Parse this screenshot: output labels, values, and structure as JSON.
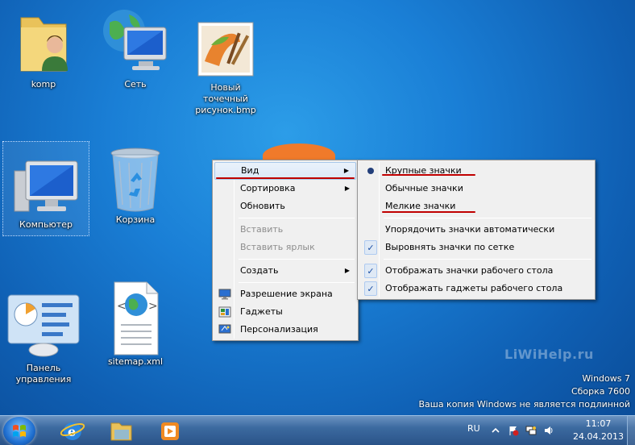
{
  "desktop": {
    "icons": [
      {
        "label": "komp"
      },
      {
        "label": "Сеть"
      },
      {
        "label": "Новый точечный рисунок.bmp"
      },
      {
        "label": "Компьютер"
      },
      {
        "label": "Корзина"
      },
      {
        "label": "Панель управления"
      },
      {
        "label": "sitemap.xml"
      }
    ],
    "site_watermark": "LiWiHelp.ru",
    "windows_info": {
      "line1": "Windows 7",
      "line2": "Сборка 7600",
      "line3": "Ваша копия Windows не является подлинной"
    }
  },
  "context_menu": {
    "items": [
      {
        "label": "Вид"
      },
      {
        "label": "Сортировка"
      },
      {
        "label": "Обновить"
      },
      {
        "label": "Вставить"
      },
      {
        "label": "Вставить ярлык"
      },
      {
        "label": "Создать"
      },
      {
        "label": "Разрешение экрана"
      },
      {
        "label": "Гаджеты"
      },
      {
        "label": "Персонализация"
      }
    ]
  },
  "view_submenu": {
    "items": [
      {
        "label": "Крупные значки"
      },
      {
        "label": "Обычные значки"
      },
      {
        "label": "Мелкие значки"
      },
      {
        "label": "Упорядочить значки автоматически"
      },
      {
        "label": "Выровнять значки по сетке"
      },
      {
        "label": "Отображать значки рабочего стола"
      },
      {
        "label": "Отображать гаджеты  рабочего стола"
      }
    ]
  },
  "taskbar": {
    "language": "RU",
    "time": "11:07",
    "date": "24.04.2013"
  },
  "colors": {
    "accent_underline": "#c00000",
    "menu_bg": "#f0f0f0",
    "desktop_blue": "#1a7fd6"
  }
}
